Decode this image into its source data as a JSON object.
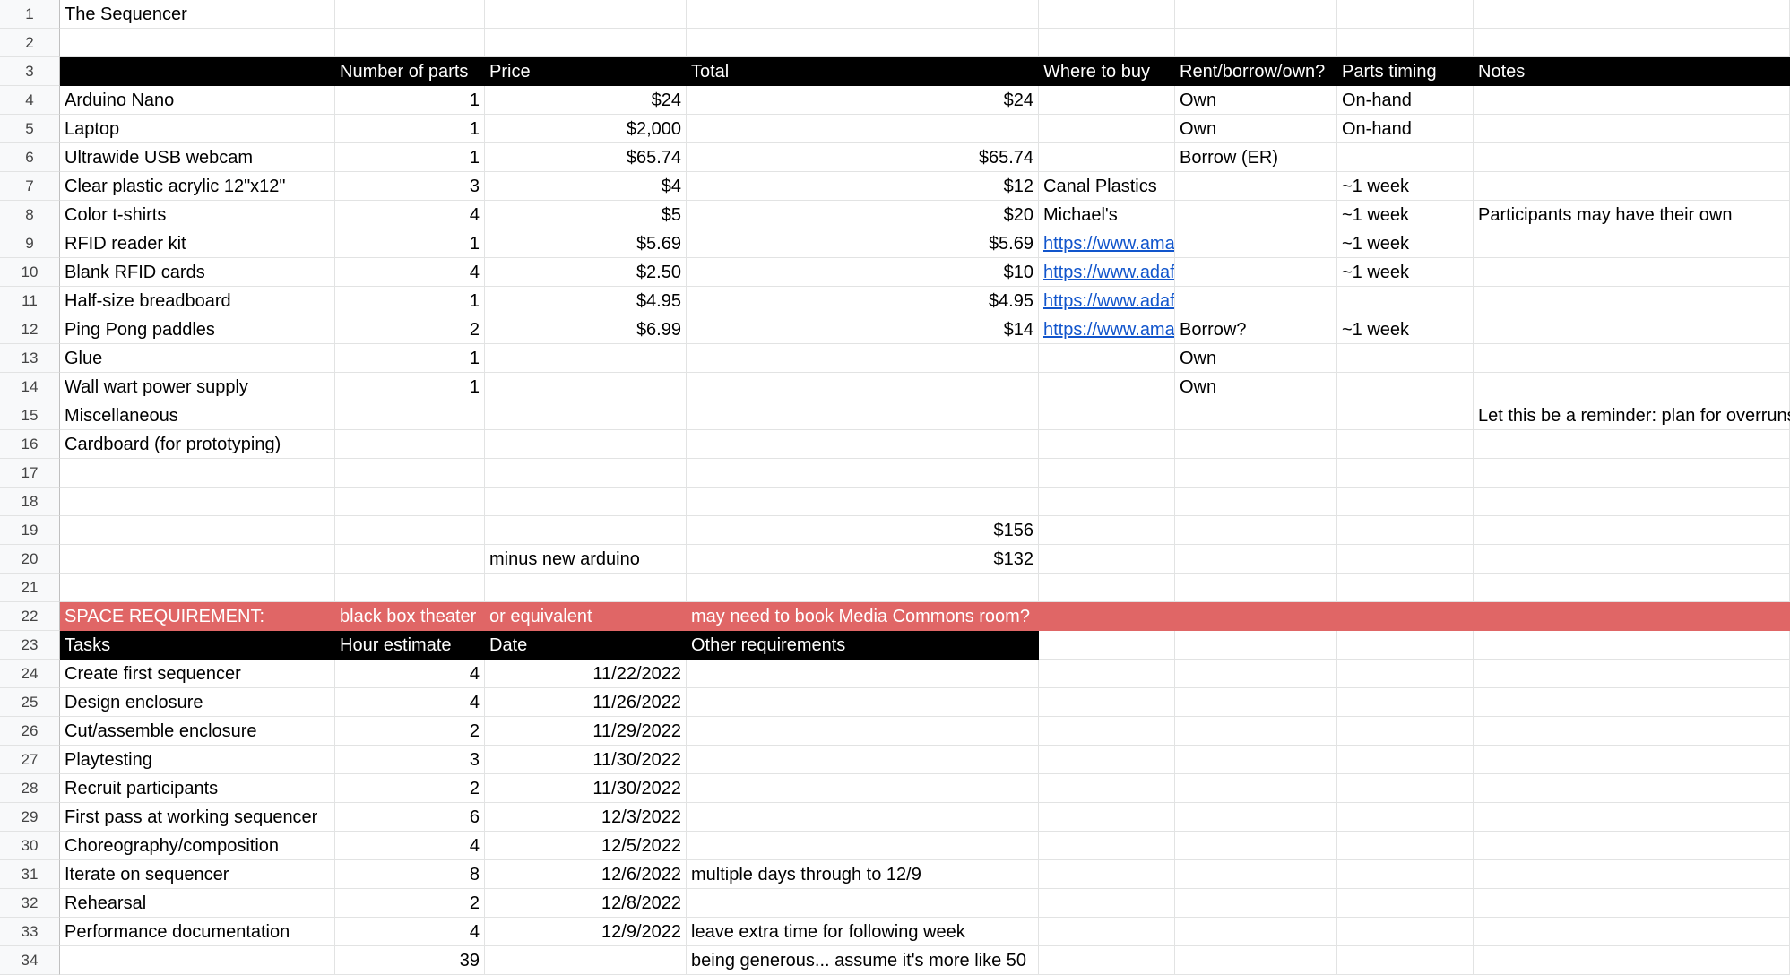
{
  "row_numbers": [
    "1",
    "2",
    "3",
    "4",
    "5",
    "6",
    "7",
    "8",
    "9",
    "10",
    "11",
    "12",
    "13",
    "14",
    "15",
    "16",
    "17",
    "18",
    "19",
    "20",
    "21",
    "22",
    "23",
    "24",
    "25",
    "26",
    "27",
    "28",
    "29",
    "30",
    "31",
    "32",
    "33",
    "34"
  ],
  "rows": {
    "1": {
      "A": "The Sequencer"
    },
    "3": {
      "A": "",
      "B": "Number of parts",
      "C": "Price",
      "D": "Total",
      "E": "Where to buy",
      "F": "Rent/borrow/own?",
      "G": "Parts timing",
      "H": "Notes"
    },
    "4": {
      "A": "Arduino Nano",
      "B": "1",
      "C": "$24",
      "D": "$24",
      "F": "Own",
      "G": "On-hand"
    },
    "5": {
      "A": "Laptop",
      "B": "1",
      "C": "$2,000",
      "F": "Own",
      "G": "On-hand"
    },
    "6": {
      "A": "Ultrawide USB webcam",
      "B": "1",
      "C": "$65.74",
      "D": "$65.74",
      "F": "Borrow (ER)"
    },
    "7": {
      "A": "Clear plastic acrylic 12\"x12\"",
      "B": "3",
      "C": "$4",
      "D": "$12",
      "E": "Canal Plastics",
      "G": "~1 week"
    },
    "8": {
      "A": "Color t-shirts",
      "B": "4",
      "C": "$5",
      "D": "$20",
      "E": "Michael's",
      "G": "~1 week",
      "H": "Participants may have their own"
    },
    "9": {
      "A": "RFID reader kit",
      "B": "1",
      "C": "$5.69",
      "D": "$5.69",
      "E": "https://www.amaz",
      "G": "~1 week"
    },
    "10": {
      "A": "Blank RFID cards",
      "B": "4",
      "C": "$2.50",
      "D": "$10",
      "E": "https://www.adafr",
      "G": "~1 week"
    },
    "11": {
      "A": "Half-size breadboard",
      "B": "1",
      "C": "$4.95",
      "D": "$4.95",
      "E": "https://www.adafr"
    },
    "12": {
      "A": "Ping Pong paddles",
      "B": "2",
      "C": "$6.99",
      "D": "$14",
      "E": "https://www.amaz",
      "F": "Borrow?",
      "G": "~1 week"
    },
    "13": {
      "A": "Glue",
      "B": "1",
      "F": "Own"
    },
    "14": {
      "A": "Wall wart power supply",
      "B": "1",
      "F": "Own"
    },
    "15": {
      "A": "Miscellaneous",
      "H": "Let this be a reminder: plan for overruns!"
    },
    "16": {
      "A": "Cardboard (for prototyping)"
    },
    "19": {
      "D": "$156"
    },
    "20": {
      "C": "minus new arduino",
      "D": "$132"
    },
    "22": {
      "A": "SPACE REQUIREMENT:",
      "B": "black box theater",
      "C": "or equivalent",
      "D": "may need to book Media Commons room?"
    },
    "23": {
      "A": "Tasks",
      "B": "Hour estimate",
      "C": "Date",
      "D": "Other requirements"
    },
    "24": {
      "A": "Create first sequencer",
      "B": "4",
      "C": "11/22/2022"
    },
    "25": {
      "A": "Design enclosure",
      "B": "4",
      "C": "11/26/2022"
    },
    "26": {
      "A": "Cut/assemble enclosure",
      "B": "2",
      "C": "11/29/2022"
    },
    "27": {
      "A": "Playtesting",
      "B": "3",
      "C": "11/30/2022"
    },
    "28": {
      "A": "Recruit participants",
      "B": "2",
      "C": "11/30/2022"
    },
    "29": {
      "A": "First pass at working sequencer",
      "B": "6",
      "C": "12/3/2022"
    },
    "30": {
      "A": "Choreography/composition",
      "B": "4",
      "C": "12/5/2022"
    },
    "31": {
      "A": "Iterate on sequencer",
      "B": "8",
      "C": "12/6/2022",
      "D": "multiple days through to 12/9"
    },
    "32": {
      "A": "Rehearsal",
      "B": "2",
      "C": "12/8/2022"
    },
    "33": {
      "A": "Performance documentation",
      "B": "4",
      "C": "12/9/2022",
      "D": "leave extra time for following week"
    },
    "34": {
      "B": "39",
      "D": "being generous... assume it's more like 50"
    }
  }
}
